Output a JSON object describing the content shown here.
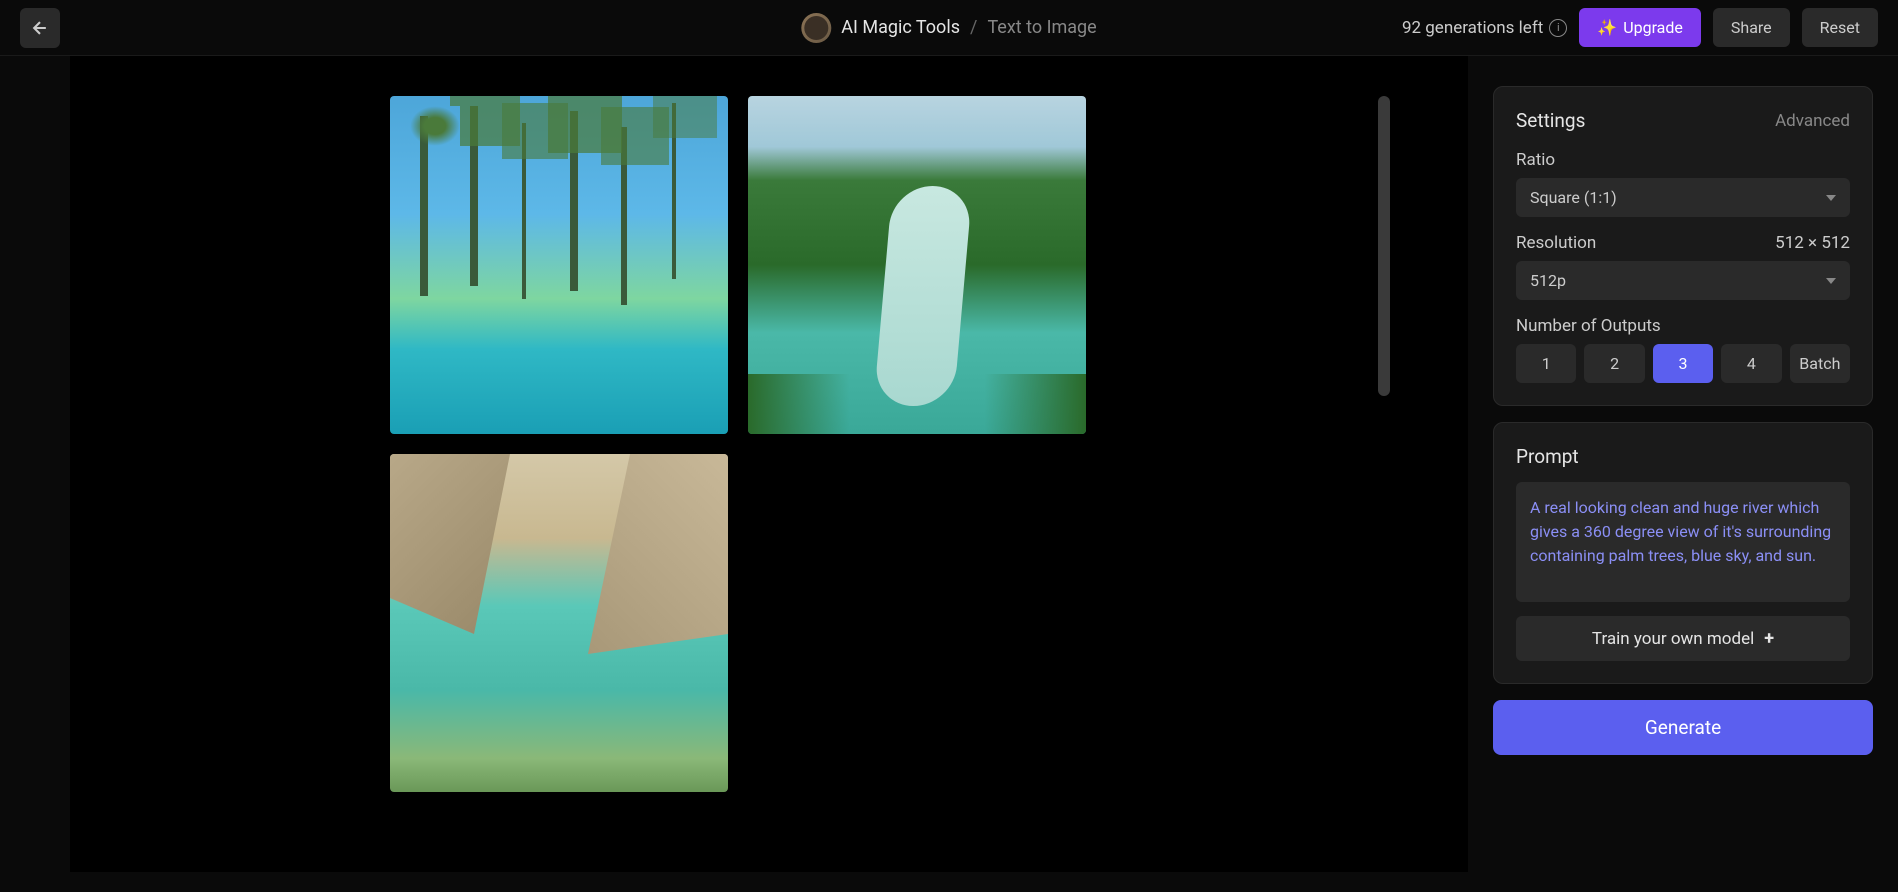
{
  "header": {
    "breadcrumb_main": "AI Magic Tools",
    "breadcrumb_separator": "/",
    "breadcrumb_sub": "Text to Image",
    "generations_left": "92 generations left",
    "upgrade_label": "Upgrade",
    "share_label": "Share",
    "reset_label": "Reset"
  },
  "settings": {
    "title": "Settings",
    "advanced_label": "Advanced",
    "ratio_label": "Ratio",
    "ratio_value": "Square (1:1)",
    "resolution_label": "Resolution",
    "resolution_value": "512 × 512",
    "resolution_select": "512p",
    "outputs_label": "Number of Outputs",
    "outputs": {
      "opt1": "1",
      "opt2": "2",
      "opt3": "3",
      "opt4": "4",
      "batch": "Batch"
    },
    "active_output": "3"
  },
  "prompt": {
    "title": "Prompt",
    "text": "A real looking clean and huge river which gives a 360 degree view of it's surrounding containing palm trees, blue sky, and sun.",
    "train_label": "Train your own model"
  },
  "generate_label": "Generate"
}
